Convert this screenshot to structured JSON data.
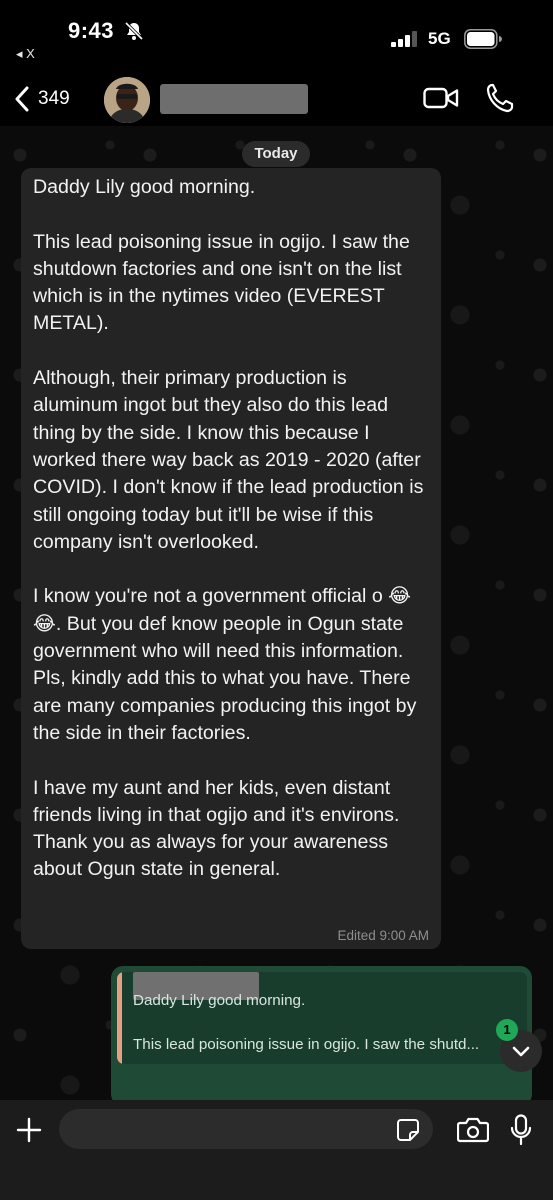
{
  "status_bar": {
    "time": "9:43",
    "back_app_label": "◂ X",
    "network": "5G"
  },
  "header": {
    "back_count": "349",
    "contact_name": "",
    "icons": [
      "chevron-left-icon",
      "video-call-icon",
      "phone-icon"
    ]
  },
  "date_separator": "Today",
  "message": {
    "text": "Daddy Lily good morning.\n\nThis lead poisoning issue in ogijo. I saw the shutdown factories and one isn't on the list which is in the nytimes video (EVEREST METAL).\n\nAlthough, their primary production is aluminum ingot but they also do this lead thing by the side. I know this because I worked there way back as 2019 - 2020 (after COVID). I don't know if the lead production is still ongoing today but it'll be wise if this company isn't overlooked.\n\nI know you're not a government official o 😂😂. But you def know people in Ogun state government who will need this information. Pls, kindly add this to what you have. There are many companies producing this ingot by the side in their factories.\n\nI have my aunt and her kids, even distant friends living in that ogijo and it's environs. Thank you as always for your awareness about Ogun state in general.",
    "meta": "Edited 9:00 AM"
  },
  "reply": {
    "quoted_author": "",
    "quoted_line1": "Daddy Lily good morning.",
    "quoted_line2": "This lead poisoning issue in ogijo. I saw the shutd..."
  },
  "unread_count": "1",
  "composer": {
    "placeholder": "",
    "icons": [
      "plus-icon",
      "sticker-icon",
      "camera-icon",
      "microphone-icon"
    ]
  },
  "colors": {
    "incoming_bubble": "#242424",
    "outgoing_bubble": "#1f4a36",
    "quote_accent": "#e7a07f",
    "unread_badge": "#1fa855"
  }
}
